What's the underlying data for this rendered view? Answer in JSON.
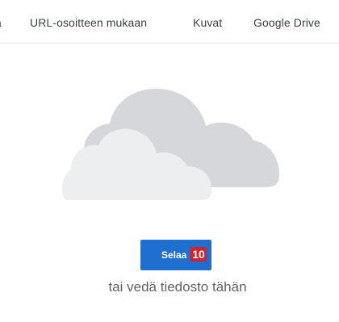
{
  "tabs": [
    {
      "label": "a"
    },
    {
      "label": "URL-osoitteen mukaan"
    },
    {
      "label": "Kuvat"
    },
    {
      "label": "Google Drive"
    }
  ],
  "upload": {
    "cloud_icon": "cloud-icon",
    "browse_label": "Selaa",
    "hint_badge": "10",
    "drop_hint": "tai vedä tiedosto tähän"
  },
  "colors": {
    "button": "#1f6fd1",
    "badge": "#d6202a",
    "cloud_back": "#d5d7da",
    "cloud_front": "#eceeef",
    "divider": "#e3e3e3"
  }
}
